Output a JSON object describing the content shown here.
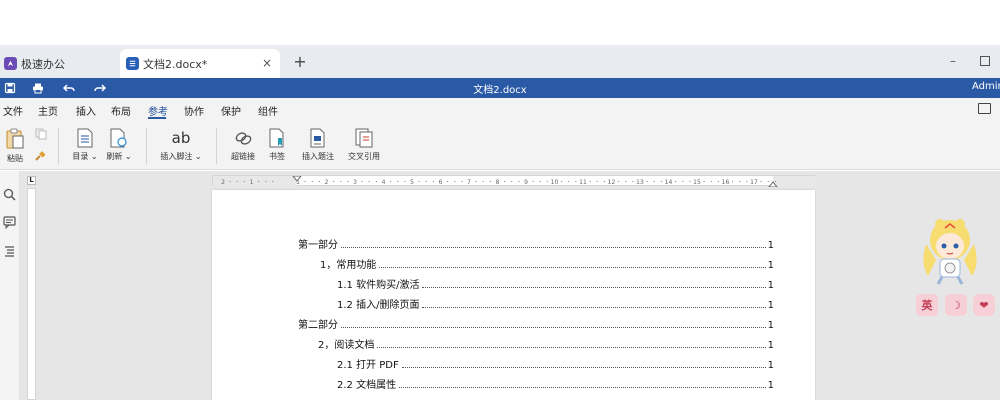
{
  "tabs": {
    "app_label": "极速办公",
    "doc_label": "文档2.docx*",
    "close_glyph": "×",
    "new_tab_glyph": "+"
  },
  "window": {
    "minimize_glyph": "–"
  },
  "titlebar": {
    "title": "文档2.docx",
    "user": "Adminis"
  },
  "menu": {
    "items": [
      "文件",
      "主页",
      "插入",
      "布局",
      "参考",
      "协作",
      "保护",
      "组件"
    ],
    "active": "参考"
  },
  "ribbon": {
    "paste": "粘贴",
    "toc": "目录",
    "refresh": "刷新",
    "insert_footnote": "插入脚注",
    "footnote_icon_text": "ab",
    "hyperlink": "超链接",
    "bookmark": "书签",
    "insert_caption": "插入题注",
    "cross_ref": "交叉引用",
    "dropdown_glyph": "⌄"
  },
  "ruler": {
    "corner": "L",
    "marks": [
      "2",
      "1",
      "1",
      "2",
      "3",
      "4",
      "5",
      "6",
      "7",
      "8",
      "9",
      "10",
      "11",
      "12",
      "13",
      "14",
      "15",
      "16",
      "17"
    ]
  },
  "toc": [
    {
      "text": "第一部分",
      "page": "1"
    },
    {
      "text": "1，常用功能",
      "page": "1"
    },
    {
      "text": "1.1 软件购买/激活",
      "page": "1"
    },
    {
      "text": "1.2 插入/删除页面",
      "page": "1"
    },
    {
      "text": "第二部分",
      "page": "1"
    },
    {
      "text": "2，阅读文档",
      "page": "1"
    },
    {
      "text": "2.1 打开 PDF",
      "page": "1"
    },
    {
      "text": "2.2 文档属性",
      "page": "1"
    }
  ],
  "mascot": {
    "btn_lang": "英",
    "btn_moon": "☽",
    "btn_heart": "❤"
  },
  "colors": {
    "titlebar": "#2a5aa5",
    "accent": "#2a5aa5",
    "app_icon": "#6b4bb5"
  }
}
